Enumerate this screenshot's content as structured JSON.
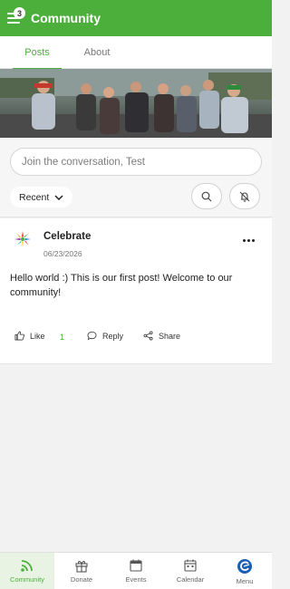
{
  "header": {
    "title": "Community",
    "menu_badge": "3",
    "menu_icon": "hamburger-menu-icon"
  },
  "tabs": [
    {
      "label": "Posts",
      "active": true
    },
    {
      "label": "About",
      "active": false
    }
  ],
  "banner": {
    "icon": "group-photo-banner"
  },
  "composer": {
    "placeholder": "Join the conversation, Test",
    "sort_label": "Recent",
    "search_icon": "search-icon",
    "notifications_icon": "bell-off-icon"
  },
  "post": {
    "author": "Celebrate",
    "date": "06/23/2026",
    "body": "Hello world :) This is our first post! Welcome to our community!",
    "like_label": "Like",
    "like_count": "1",
    "reply_label": "Reply",
    "share_label": "Share"
  },
  "nav": [
    {
      "label": "Community",
      "icon": "community-feed-icon",
      "active": true
    },
    {
      "label": "Donate",
      "icon": "gift-icon",
      "active": false
    },
    {
      "label": "Events",
      "icon": "events-calendar-icon",
      "active": false
    },
    {
      "label": "Calendar",
      "icon": "calendar-icon",
      "active": false
    },
    {
      "label": "Menu",
      "icon": "menu-logo-icon",
      "active": false
    }
  ],
  "colors": {
    "brand_green": "#4caf3c",
    "nav_active_bg": "#e8f3e4",
    "like_count": "#4caf3c"
  }
}
